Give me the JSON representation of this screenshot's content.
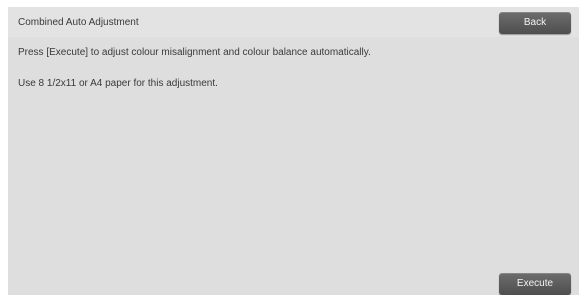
{
  "header": {
    "title": "Combined Auto Adjustment",
    "back_label": "Back"
  },
  "main": {
    "message_1": "Press [Execute] to adjust colour misalignment and colour balance automatically.",
    "message_2": "Use 8 1/2x11 or A4 paper for this adjustment."
  },
  "footer": {
    "execute_label": "Execute"
  },
  "colors": {
    "panel_background": "#dedede",
    "button_background": "#5c5c5c",
    "button_text": "#f4f4f4",
    "text": "#3a3a3a"
  }
}
